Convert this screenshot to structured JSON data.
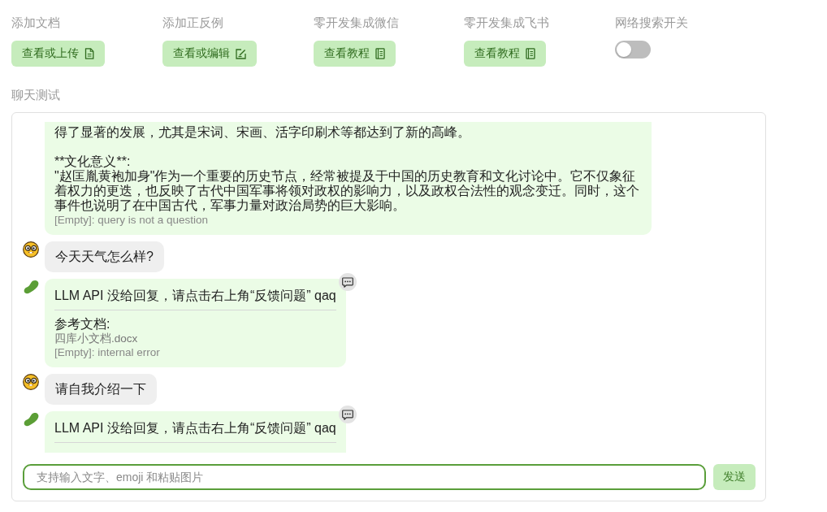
{
  "toolbar": [
    {
      "kind": "button",
      "label": "添加文档",
      "button": "查看或上传"
    },
    {
      "kind": "button",
      "label": "添加正反例",
      "button": "查看或编辑"
    },
    {
      "kind": "button",
      "label": "零开发集成微信",
      "button": "查看教程"
    },
    {
      "kind": "button",
      "label": "零开发集成飞书",
      "button": "查看教程"
    },
    {
      "kind": "toggle",
      "label": "网络搜索开关",
      "on": false
    }
  ],
  "section_title": "聊天测试",
  "chat": {
    "messages": [
      {
        "kind": "bot",
        "cut_top": true,
        "cut_bottom": false,
        "text": "得了显著的发展，尤其是宋词、宋画、活字印刷术等都达到了新的高峰。\n\n**文化意义**:\n\"赵匡胤黄袍加身\"作为一个重要的历史节点，经常被提及于中国的历史教育和文化讨论中。它不仅象征着权力的更迭，也反映了古代中国军事将领对政权的影响力，以及政权合法性的观念变迁。同时，这个事件也说明了在中国古代，军事力量对政治局势的巨大影响。",
        "divider": false,
        "status": "[Empty]: query is not a question",
        "feedback_button": false
      },
      {
        "kind": "user",
        "cut_top": false,
        "cut_bottom": false,
        "text": "今天天气怎么样?"
      },
      {
        "kind": "bot",
        "cut_top": false,
        "cut_bottom": false,
        "text": "LLM API 没给回复，请点击右上角“反馈问题” qaq",
        "divider": true,
        "references_title": "参考文档:",
        "references": [
          "四库小文档.docx"
        ],
        "status": "[Empty]: internal error",
        "feedback_button": true
      },
      {
        "kind": "user",
        "cut_top": false,
        "cut_bottom": false,
        "text": "请自我介绍一下"
      },
      {
        "kind": "bot",
        "cut_top": false,
        "cut_bottom": true,
        "text": "LLM API 没给回复，请点击右上角“反馈问题” qaq",
        "divider": true,
        "feedback_button": true
      }
    ]
  },
  "input": {
    "placeholder": "支持输入文字、emoji 和粘贴图片",
    "send_button": "发送"
  }
}
